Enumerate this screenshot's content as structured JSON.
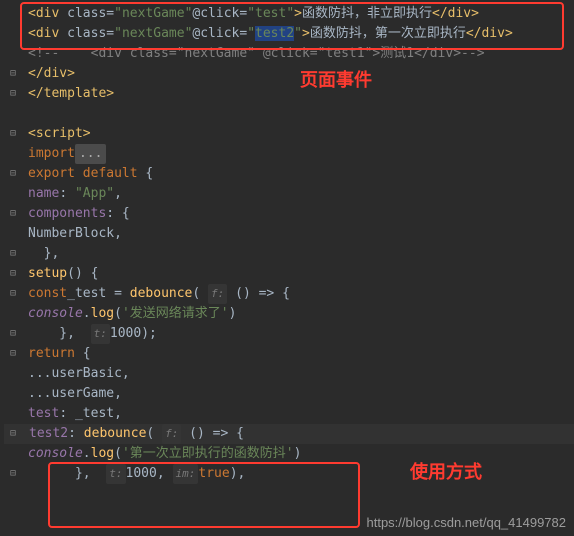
{
  "lines": {
    "l1_class": "nextGame",
    "l1_event": "test",
    "l1_text": "函数防抖，非立即执行",
    "l2_class": "nextGame",
    "l2_event": "test2",
    "l2_text": "函数防抖，第一次立即执行",
    "l3_comment_class": "nextGame",
    "l3_comment_event": "test1",
    "l3_comment_text": "测试1",
    "l4_close": "</div>",
    "l5_close": "</template>",
    "l7_tag": "<script>",
    "l8_import": "import",
    "l8_ellipsis": "...",
    "l9_export": "export default",
    "l10_name_key": "name",
    "l10_name_val": "\"App\"",
    "l11_components": "components",
    "l12_comp": "NumberBlock",
    "l14_setup": "setup",
    "l15_const": "const",
    "l15_var": "_test",
    "l15_fn": "debounce",
    "l15_hint": "f:",
    "l16_console": "console",
    "l16_log": "log",
    "l16_msg": "'发送网络请求了'",
    "l17_hint": "t:",
    "l17_val": "1000",
    "l18_return": "return",
    "l19_spread": "...userBasic",
    "l20_spread": "...userGame",
    "l21_key": "test",
    "l21_val": "_test",
    "l22_key": "test2",
    "l22_fn": "debounce",
    "l22_hint": "f:",
    "l23_console": "console",
    "l23_log": "log",
    "l23_msg": "'第一次立即执行的函数防抖'",
    "l24_hint1": "t:",
    "l24_val1": "1000",
    "l24_hint2": "im:",
    "l24_val2": "true"
  },
  "annotations": {
    "top_label": "页面事件",
    "bottom_label": "使用方式"
  },
  "watermark": "https://blog.csdn.net/qq_41499782"
}
